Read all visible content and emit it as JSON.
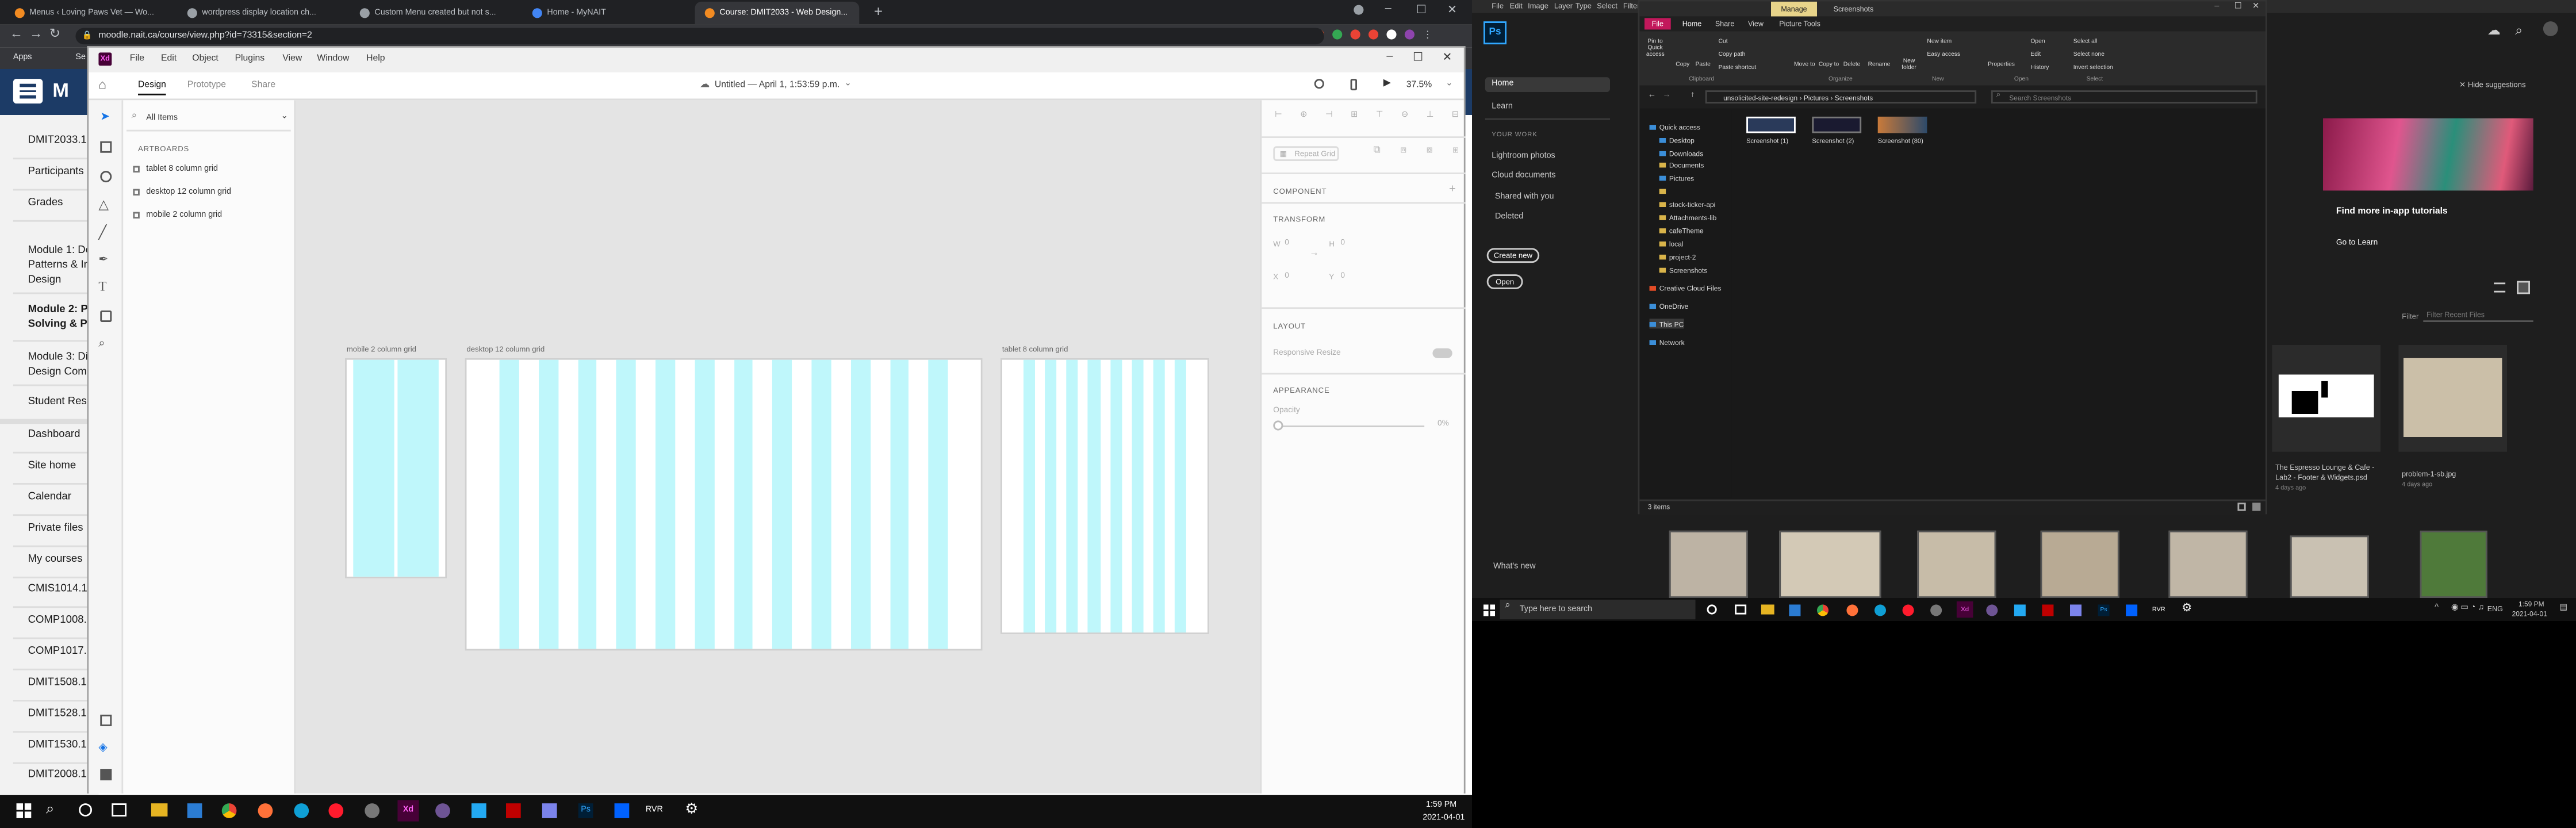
{
  "browser": {
    "tabs": [
      {
        "label": "Menus ‹ Loving Paws Vet — Wo...",
        "active": false
      },
      {
        "label": "wordpress display location ch...",
        "active": false
      },
      {
        "label": "Custom Menu created but not s...",
        "active": false
      },
      {
        "label": "Home - MyNAIT",
        "active": false
      },
      {
        "label": "Course: DMIT2033 - Web Design...",
        "active": true
      }
    ],
    "url": "moodle.nait.ca/course/view.php?id=73315&section=2",
    "bookmarks": [
      "Apps",
      "Se"
    ]
  },
  "moodle": {
    "sidebar_items": [
      "DMIT2033.12",
      "Participants",
      "Grades",
      "Module 1: De Patterns & In Design",
      "Module 2: Pr Solving & Pr",
      "Module 3: Di Design Comp",
      "Student Reso",
      "Dashboard",
      "Site home",
      "Calendar",
      "Private files",
      "My courses",
      "CMIS1014.1",
      "COMP1008.",
      "COMP1017.",
      "DMIT1508.1",
      "DMIT1528.1",
      "DMIT1530.1",
      "DMIT2008.1"
    ]
  },
  "xd": {
    "menu": [
      "File",
      "Edit",
      "Object",
      "Plugins",
      "View",
      "Window",
      "Help"
    ],
    "modes": [
      "Design",
      "Prototype",
      "Share"
    ],
    "doc_title": "Untitled — April 1, 1:53:59 p.m.",
    "zoom": "37.5%",
    "filter": "All Items",
    "artboards_heading": "ARTBOARDS",
    "artboards": [
      "tablet 8 column grid",
      "desktop 12 column grid",
      "mobile 2 column grid"
    ],
    "canvas_labels": {
      "mobile": "mobile 2 column grid",
      "desktop": "desktop 12 column grid",
      "tablet": "tablet 8 column grid"
    },
    "grid_columns": {
      "mobile": 2,
      "desktop": 12,
      "tablet": 8
    },
    "right": {
      "repeat_grid": "Repeat Grid",
      "component": "COMPONENT",
      "transform": "TRANSFORM",
      "w": "W",
      "w_val": "0",
      "h": "H",
      "h_val": "0",
      "x": "X",
      "x_val": "0",
      "y": "Y",
      "y_val": "0",
      "layout": "LAYOUT",
      "responsive": "Responsive Resize",
      "appearance": "APPEARANCE",
      "opacity": "Opacity",
      "opacity_val": "0%"
    }
  },
  "photoshop": {
    "menu": [
      "File",
      "Edit",
      "Image",
      "Layer",
      "Type",
      "Select",
      "Filter"
    ],
    "nav": [
      "Home",
      "Learn"
    ],
    "your_work": "YOUR WORK",
    "work_items": [
      "Lightroom photos",
      "Cloud documents",
      "Shared with you",
      "Deleted"
    ],
    "create_new": "Create new",
    "open": "Open",
    "whats_new": "What's new",
    "hide_suggestions": "Hide suggestions",
    "tutorial_title": "Find more in-app tutorials",
    "tutorial_link": "Go to Learn",
    "filter": "Filter",
    "filter_placeholder": "Filter Recent Files",
    "recent": [
      {
        "name": "The Espresso Lounge & Cafe - Lab2 - Footer & Widgets.psd",
        "age": "4 days ago"
      },
      {
        "name": "problem-1-sb.jpg",
        "age": "4 days ago"
      }
    ]
  },
  "explorer": {
    "ribbon_tabs": [
      "File",
      "Home",
      "Share",
      "View",
      "Picture Tools"
    ],
    "manage": "Manage",
    "title": "Screenshots",
    "ribbon_groups": [
      "Clipboard",
      "Organize",
      "New",
      "Open",
      "Select"
    ],
    "ribbon_buttons": [
      "Pin to Quick access",
      "Copy",
      "Paste",
      "Move to",
      "Copy to",
      "Delete",
      "Rename",
      "New folder",
      "Properties"
    ],
    "ribbon_small": [
      "Cut",
      "Copy path",
      "Paste shortcut",
      "New item",
      "Easy access",
      "Open",
      "Edit",
      "History",
      "Select all",
      "Select none",
      "Invert selection"
    ],
    "breadcrumb": [
      "unsolicited-site-redesign",
      "Pictures",
      "Screenshots"
    ],
    "search_placeholder": "Search Screenshots",
    "nav": [
      "Quick access",
      "Desktop",
      "Downloads",
      "Documents",
      "Pictures",
      "",
      "stock-ticker-api",
      "Attachments-lib",
      "cafeTheme",
      "local",
      "project-2",
      "Screenshots",
      "Creative Cloud Files",
      "OneDrive",
      "This PC",
      "Network"
    ],
    "files": [
      "Screenshot (1)",
      "Screenshot (2)",
      "Screenshot (80)"
    ],
    "status": "3 items"
  },
  "taskbar": {
    "search_placeholder": "Type here to search",
    "time_right": "1:59 PM",
    "date_right": "2021-04-01",
    "time_left": "1:59 PM",
    "date_left": "2021-04-01",
    "lang": "ENG"
  }
}
